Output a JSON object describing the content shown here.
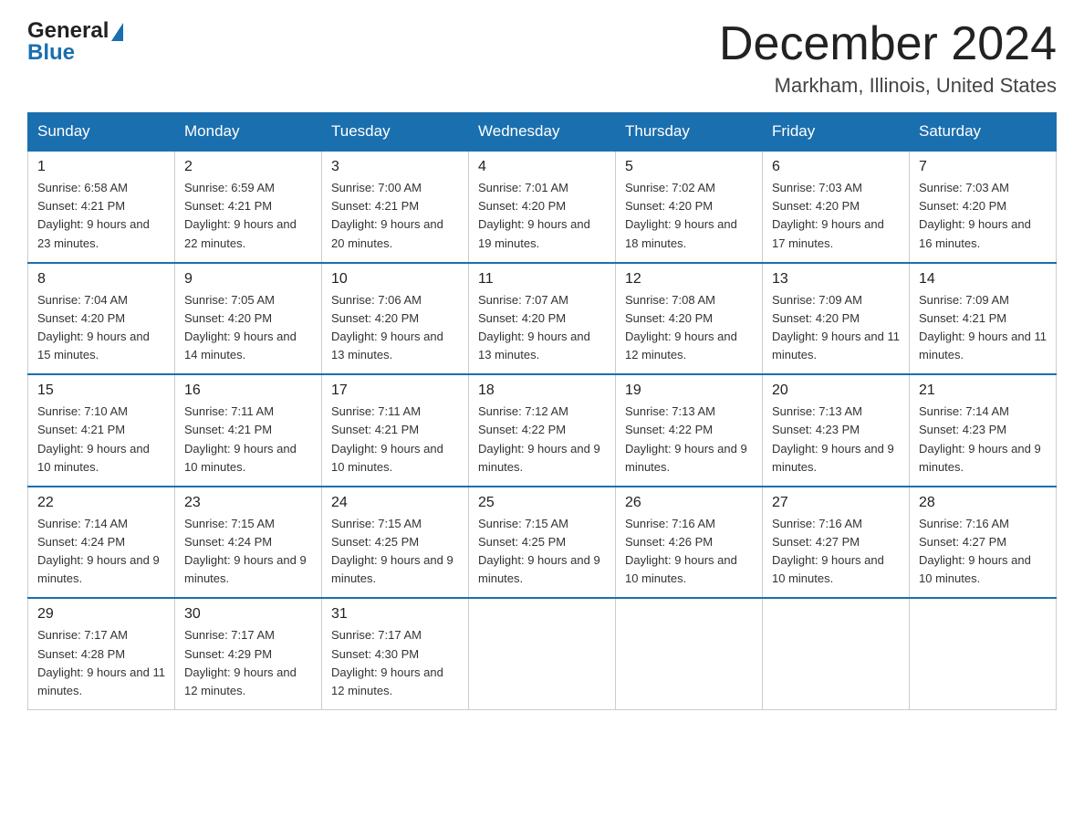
{
  "header": {
    "logo_general": "General",
    "logo_blue": "Blue",
    "month_title": "December 2024",
    "location": "Markham, Illinois, United States"
  },
  "calendar": {
    "days_of_week": [
      "Sunday",
      "Monday",
      "Tuesday",
      "Wednesday",
      "Thursday",
      "Friday",
      "Saturday"
    ],
    "weeks": [
      [
        {
          "day": "1",
          "sunrise": "6:58 AM",
          "sunset": "4:21 PM",
          "daylight": "9 hours and 23 minutes."
        },
        {
          "day": "2",
          "sunrise": "6:59 AM",
          "sunset": "4:21 PM",
          "daylight": "9 hours and 22 minutes."
        },
        {
          "day": "3",
          "sunrise": "7:00 AM",
          "sunset": "4:21 PM",
          "daylight": "9 hours and 20 minutes."
        },
        {
          "day": "4",
          "sunrise": "7:01 AM",
          "sunset": "4:20 PM",
          "daylight": "9 hours and 19 minutes."
        },
        {
          "day": "5",
          "sunrise": "7:02 AM",
          "sunset": "4:20 PM",
          "daylight": "9 hours and 18 minutes."
        },
        {
          "day": "6",
          "sunrise": "7:03 AM",
          "sunset": "4:20 PM",
          "daylight": "9 hours and 17 minutes."
        },
        {
          "day": "7",
          "sunrise": "7:03 AM",
          "sunset": "4:20 PM",
          "daylight": "9 hours and 16 minutes."
        }
      ],
      [
        {
          "day": "8",
          "sunrise": "7:04 AM",
          "sunset": "4:20 PM",
          "daylight": "9 hours and 15 minutes."
        },
        {
          "day": "9",
          "sunrise": "7:05 AM",
          "sunset": "4:20 PM",
          "daylight": "9 hours and 14 minutes."
        },
        {
          "day": "10",
          "sunrise": "7:06 AM",
          "sunset": "4:20 PM",
          "daylight": "9 hours and 13 minutes."
        },
        {
          "day": "11",
          "sunrise": "7:07 AM",
          "sunset": "4:20 PM",
          "daylight": "9 hours and 13 minutes."
        },
        {
          "day": "12",
          "sunrise": "7:08 AM",
          "sunset": "4:20 PM",
          "daylight": "9 hours and 12 minutes."
        },
        {
          "day": "13",
          "sunrise": "7:09 AM",
          "sunset": "4:20 PM",
          "daylight": "9 hours and 11 minutes."
        },
        {
          "day": "14",
          "sunrise": "7:09 AM",
          "sunset": "4:21 PM",
          "daylight": "9 hours and 11 minutes."
        }
      ],
      [
        {
          "day": "15",
          "sunrise": "7:10 AM",
          "sunset": "4:21 PM",
          "daylight": "9 hours and 10 minutes."
        },
        {
          "day": "16",
          "sunrise": "7:11 AM",
          "sunset": "4:21 PM",
          "daylight": "9 hours and 10 minutes."
        },
        {
          "day": "17",
          "sunrise": "7:11 AM",
          "sunset": "4:21 PM",
          "daylight": "9 hours and 10 minutes."
        },
        {
          "day": "18",
          "sunrise": "7:12 AM",
          "sunset": "4:22 PM",
          "daylight": "9 hours and 9 minutes."
        },
        {
          "day": "19",
          "sunrise": "7:13 AM",
          "sunset": "4:22 PM",
          "daylight": "9 hours and 9 minutes."
        },
        {
          "day": "20",
          "sunrise": "7:13 AM",
          "sunset": "4:23 PM",
          "daylight": "9 hours and 9 minutes."
        },
        {
          "day": "21",
          "sunrise": "7:14 AM",
          "sunset": "4:23 PM",
          "daylight": "9 hours and 9 minutes."
        }
      ],
      [
        {
          "day": "22",
          "sunrise": "7:14 AM",
          "sunset": "4:24 PM",
          "daylight": "9 hours and 9 minutes."
        },
        {
          "day": "23",
          "sunrise": "7:15 AM",
          "sunset": "4:24 PM",
          "daylight": "9 hours and 9 minutes."
        },
        {
          "day": "24",
          "sunrise": "7:15 AM",
          "sunset": "4:25 PM",
          "daylight": "9 hours and 9 minutes."
        },
        {
          "day": "25",
          "sunrise": "7:15 AM",
          "sunset": "4:25 PM",
          "daylight": "9 hours and 9 minutes."
        },
        {
          "day": "26",
          "sunrise": "7:16 AM",
          "sunset": "4:26 PM",
          "daylight": "9 hours and 10 minutes."
        },
        {
          "day": "27",
          "sunrise": "7:16 AM",
          "sunset": "4:27 PM",
          "daylight": "9 hours and 10 minutes."
        },
        {
          "day": "28",
          "sunrise": "7:16 AM",
          "sunset": "4:27 PM",
          "daylight": "9 hours and 10 minutes."
        }
      ],
      [
        {
          "day": "29",
          "sunrise": "7:17 AM",
          "sunset": "4:28 PM",
          "daylight": "9 hours and 11 minutes."
        },
        {
          "day": "30",
          "sunrise": "7:17 AM",
          "sunset": "4:29 PM",
          "daylight": "9 hours and 12 minutes."
        },
        {
          "day": "31",
          "sunrise": "7:17 AM",
          "sunset": "4:30 PM",
          "daylight": "9 hours and 12 minutes."
        },
        null,
        null,
        null,
        null
      ]
    ]
  }
}
